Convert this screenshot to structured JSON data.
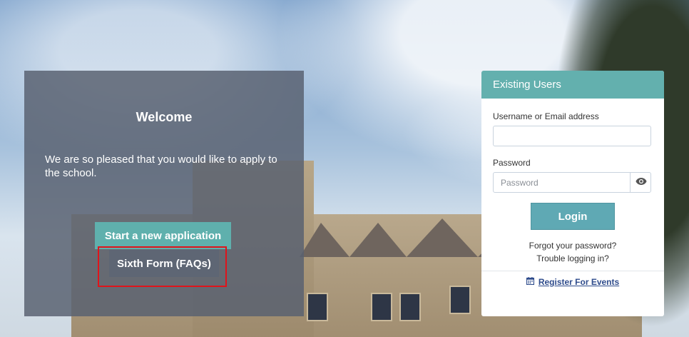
{
  "welcome": {
    "title": "Welcome",
    "message": "We are so pleased that you would like to apply to the school.",
    "start_button": "Start a new application",
    "faq_button": "Sixth Form (FAQs)"
  },
  "login": {
    "header": "Existing Users",
    "username_label": "Username or Email address",
    "username_value": "",
    "password_label": "Password",
    "password_placeholder": "Password",
    "login_button": "Login",
    "forgot_password": "Forgot your password?",
    "trouble_logging_in": "Trouble logging in?",
    "register_events": "Register For Events"
  },
  "icons": {
    "eye": "eye-icon",
    "calendar": "calendar-icon"
  },
  "colors": {
    "accent": "#63b0ae",
    "panel_overlay": "#586070",
    "link": "#2f4c8c",
    "highlight": "#e0141b"
  }
}
